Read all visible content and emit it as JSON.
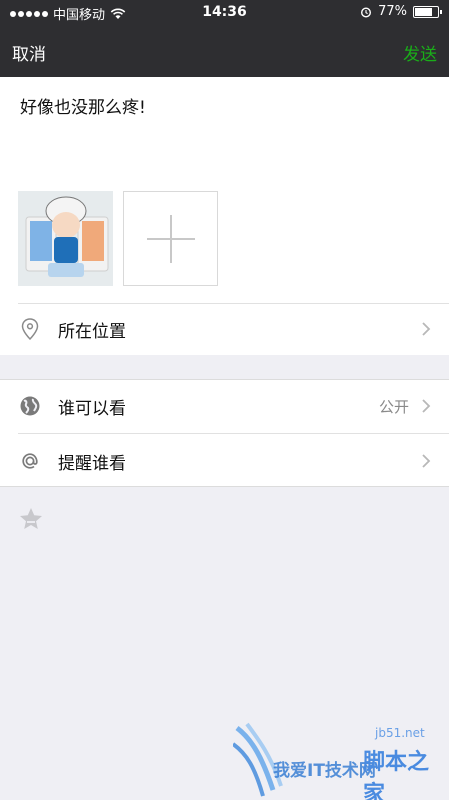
{
  "status_bar": {
    "carrier": "中国移动",
    "time": "14:36",
    "battery_percent": "77%",
    "battery_level": 0.77
  },
  "nav": {
    "cancel_label": "取消",
    "send_label": "发送",
    "send_color": "#1aad19"
  },
  "compose": {
    "text": "好像也没那么疼!",
    "photo_count": 1
  },
  "location_row": {
    "label": "所在位置",
    "icon": "location-pin-icon"
  },
  "visibility_row": {
    "label": "谁可以看",
    "value": "公开",
    "icon": "globe-icon"
  },
  "mention_row": {
    "label": "提醒谁看",
    "icon": "at-icon"
  },
  "watermark": {
    "url": "jb51.net",
    "brand_left": "我爱IT技术网",
    "brand_right": "脚本之家"
  }
}
